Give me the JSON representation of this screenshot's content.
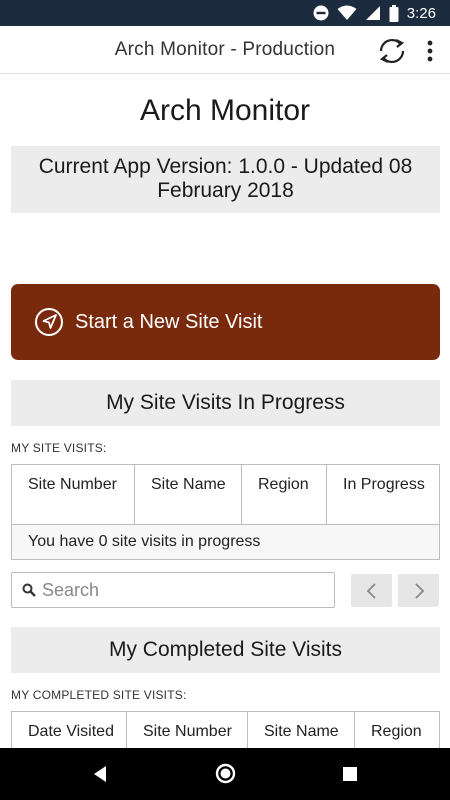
{
  "status_bar": {
    "time": "3:26",
    "icons": [
      "do-not-disturb-icon",
      "wifi-icon",
      "signal-icon",
      "battery-icon"
    ]
  },
  "app_bar": {
    "title": "Arch Monitor - Production",
    "icons": [
      "sync-icon",
      "more-vert-icon"
    ]
  },
  "page": {
    "title": "Arch Monitor",
    "version_text": "Current App Version: 1.0.0 - Updated 08 February 2018"
  },
  "start_button": {
    "label": "Start a New Site Visit",
    "icon": "navigation-arrow-icon",
    "color": "#7a2a0c"
  },
  "in_progress": {
    "header": "My Site Visits In Progress",
    "caption": "MY SITE VISITS:",
    "columns": [
      "Site Number",
      "Site Name",
      "Region",
      "In Progress"
    ],
    "empty_message": "You have 0 site visits in progress"
  },
  "search": {
    "placeholder": "Search",
    "value": ""
  },
  "completed": {
    "header": "My Completed Site Visits",
    "caption": "MY COMPLETED SITE VISITS:",
    "columns": [
      "Date Visited",
      "Site Number",
      "Site Name",
      "Region"
    ]
  },
  "colors": {
    "status_bar": "#1c2b3d",
    "section_bg": "#ececec"
  }
}
